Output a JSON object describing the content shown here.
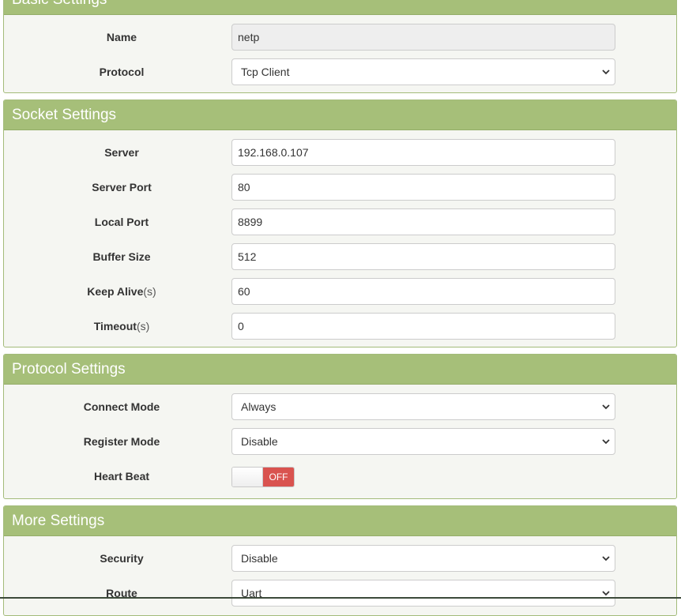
{
  "panels": {
    "basic": {
      "title": "Basic Settings",
      "name": {
        "label": "Name",
        "value": "netp"
      },
      "protocol": {
        "label": "Protocol",
        "value": "Tcp Client"
      }
    },
    "socket": {
      "title": "Socket Settings",
      "server": {
        "label": "Server",
        "value": "192.168.0.107"
      },
      "server_port": {
        "label": "Server Port",
        "value": "80"
      },
      "local_port": {
        "label": "Local Port",
        "value": "8899"
      },
      "buffer_size": {
        "label": "Buffer Size",
        "value": "512"
      },
      "keep_alive": {
        "label": "Keep Alive",
        "unit": "(s)",
        "value": "60"
      },
      "timeout": {
        "label": "Timeout",
        "unit": "(s)",
        "value": "0"
      }
    },
    "protocol": {
      "title": "Protocol Settings",
      "connect_mode": {
        "label": "Connect Mode",
        "value": "Always"
      },
      "register_mode": {
        "label": "Register Mode",
        "value": "Disable"
      },
      "heart_beat": {
        "label": "Heart Beat",
        "state": "OFF"
      }
    },
    "more": {
      "title": "More Settings",
      "security": {
        "label": "Security",
        "value": "Disable"
      },
      "route": {
        "label": "Route",
        "value": "Uart"
      }
    }
  },
  "colors": {
    "panel_header": "#a6bf79",
    "panel_border": "#a3bb7a",
    "panel_body": "#f5f6f2",
    "toggle_off": "#d9534f"
  },
  "icons": {
    "select_arrow": "chevron-down-icon"
  }
}
